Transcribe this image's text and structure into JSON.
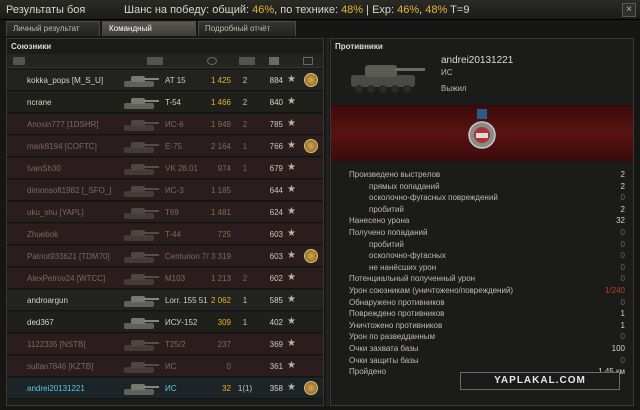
{
  "header": {
    "title": "Результаты боя",
    "chance_label": "Шанс на победу: общий: ",
    "chance_total": "46%",
    "chance_mid": ", по технике: ",
    "chance_tech": "48%",
    "chance_exp_label": " | Exp: ",
    "chance_exp1": "46%",
    "chance_sep": ", ",
    "chance_exp2": "48%",
    "chance_tier": " T=9",
    "close": "×"
  },
  "tabs": [
    {
      "label": "Личный результат"
    },
    {
      "label": "Командный результат"
    },
    {
      "label": "Подробный отчёт"
    }
  ],
  "allies": {
    "title": "Союзники",
    "rows": [
      {
        "name": "kokka_pops [M_S_U]",
        "tank": "AT 15",
        "dmg": "1 425",
        "kills": "2",
        "xp": "884",
        "medal": true,
        "state": "alive"
      },
      {
        "name": "ncrane",
        "tank": "T-54",
        "dmg": "1 466",
        "kills": "2",
        "xp": "840",
        "medal": false,
        "state": "alive"
      },
      {
        "name": "Anoxin777 [1DSHR]",
        "tank": "ИС-6",
        "dmg": "1 949",
        "kills": "2",
        "xp": "785",
        "medal": false,
        "state": "dead"
      },
      {
        "name": "mark8194 [COFTC]",
        "tank": "E-75",
        "dmg": "2 164",
        "kills": "1",
        "xp": "766",
        "medal": true,
        "state": "dead"
      },
      {
        "name": "IvanSh30",
        "tank": "VK 28.01",
        "dmg": "974",
        "kills": "1",
        "xp": "679",
        "medal": false,
        "state": "dead"
      },
      {
        "name": "dimonsoft1982 [_SFO_]",
        "tank": "ИС-3",
        "dmg": "1 185",
        "kills": "",
        "xp": "644",
        "medal": false,
        "state": "dead"
      },
      {
        "name": "uku_shu [YAPL]",
        "tank": "T69",
        "dmg": "1 481",
        "kills": "",
        "xp": "624",
        "medal": false,
        "state": "dead"
      },
      {
        "name": "Zhuebok",
        "tank": "T-44",
        "dmg": "725",
        "kills": "",
        "xp": "603",
        "medal": false,
        "state": "dead"
      },
      {
        "name": "Patriot933621 [TDM70]",
        "tank": "Centurion 7/1",
        "dmg": "3 319",
        "kills": "",
        "xp": "603",
        "medal": true,
        "state": "dead"
      },
      {
        "name": "AlexPetrov24 [WTCC]",
        "tank": "M103",
        "dmg": "1 213",
        "kills": "2",
        "xp": "602",
        "medal": false,
        "state": "dead"
      },
      {
        "name": "androargun",
        "tank": "Lorr. 155 51",
        "dmg": "2 062",
        "kills": "1",
        "xp": "585",
        "medal": false,
        "state": "alive"
      },
      {
        "name": "ded367",
        "tank": "ИСУ-152",
        "dmg": "309",
        "kills": "1",
        "xp": "402",
        "medal": false,
        "state": "alive"
      },
      {
        "name": "1122335 [NSTB]",
        "tank": "T25/2",
        "dmg": "237",
        "kills": "",
        "xp": "369",
        "medal": false,
        "state": "dead"
      },
      {
        "name": "sultan7846 [KZTB]",
        "tank": "ИС",
        "dmg": "0",
        "kills": "",
        "xp": "361",
        "medal": false,
        "state": "dead"
      },
      {
        "name": "andrei20131221",
        "tank": "ИС",
        "dmg": "32",
        "kills": "1(1)",
        "xp": "358",
        "medal": true,
        "state": "me"
      }
    ]
  },
  "detail": {
    "title": "Противники",
    "player": "andrei20131221",
    "vehicle": "ИС",
    "status": "Выжил",
    "stats": [
      {
        "label": "Произведено выстрелов",
        "value": "2",
        "sub": false,
        "style": ""
      },
      {
        "label": "прямых попаданий",
        "value": "2",
        "sub": true,
        "style": ""
      },
      {
        "label": "осколочно-фугасных повреждений",
        "value": "0",
        "sub": true,
        "style": "zero"
      },
      {
        "label": "пробитий",
        "value": "2",
        "sub": true,
        "style": ""
      },
      {
        "label": "Нанесено урона",
        "value": "32",
        "sub": false,
        "style": ""
      },
      {
        "label": "Получено попаданий",
        "value": "0",
        "sub": false,
        "style": "zero"
      },
      {
        "label": "пробитий",
        "value": "0",
        "sub": true,
        "style": "zero"
      },
      {
        "label": "осколочно-фугасных",
        "value": "0",
        "sub": true,
        "style": "zero"
      },
      {
        "label": "не нанёсших урон",
        "value": "0",
        "sub": true,
        "style": "zero"
      },
      {
        "label": "Потенциальный полученный урон",
        "value": "0",
        "sub": false,
        "style": "zero"
      },
      {
        "label": "Урон союзникам (уничтожено/повреждений)",
        "value": "1/240",
        "sub": false,
        "style": "red"
      },
      {
        "label": "Обнаружено противников",
        "value": "0",
        "sub": false,
        "style": "zero"
      },
      {
        "label": "Повреждено противников",
        "value": "1",
        "sub": false,
        "style": ""
      },
      {
        "label": "Уничтожено противников",
        "value": "1",
        "sub": false,
        "style": ""
      },
      {
        "label": "Урон по разведданным",
        "value": "0",
        "sub": false,
        "style": "zero"
      },
      {
        "label": "Очки захвата базы",
        "value": "100",
        "sub": false,
        "style": ""
      },
      {
        "label": "Очки защиты базы",
        "value": "0",
        "sub": false,
        "style": "zero"
      },
      {
        "label": "Пройдено",
        "value": "1,45 км",
        "sub": false,
        "style": ""
      }
    ]
  },
  "watermark": "YAPLAKAL.COM",
  "colors": {
    "accent": "#e6b531",
    "me": "#59c7e3",
    "dead": "#7b6a66",
    "band": "#5a1212"
  }
}
